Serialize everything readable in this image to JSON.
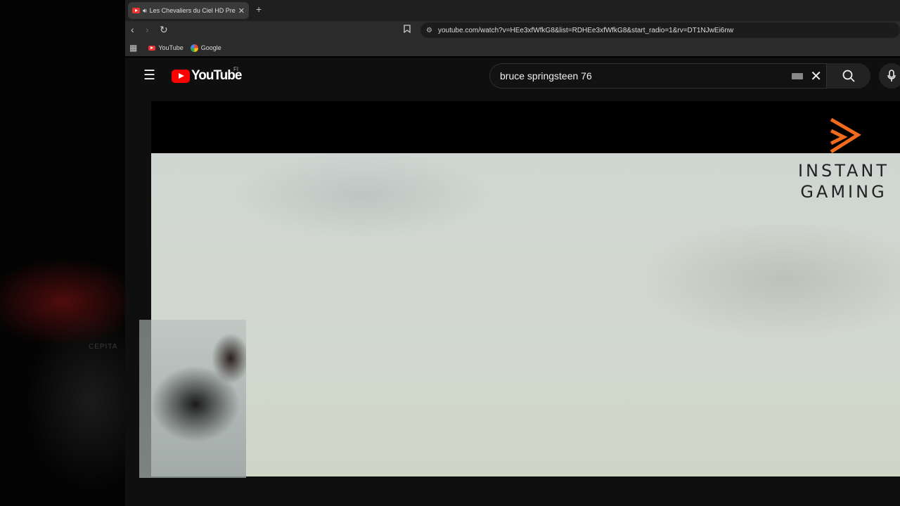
{
  "browser": {
    "tab": {
      "title": "Les Chevaliers du Ciel HD Pre",
      "audio_icon": "speaker-icon"
    },
    "toolbar": {
      "url": "youtube.com/watch?v=HEe3xfWfkG8&list=RDHEe3xfWfkG8&start_radio=1&rv=DT1NJwEi6nw"
    },
    "bookmarks": [
      {
        "label": "YouTube",
        "icon": "youtube-favicon"
      },
      {
        "label": "Google",
        "icon": "google-favicon"
      }
    ]
  },
  "youtube": {
    "logo_text": "YouTube",
    "country_code": "FI",
    "search": {
      "value": "bruce springsteen 76"
    }
  },
  "player": {
    "watermark": {
      "line1": "INSTANT",
      "line2": "GAMING"
    }
  },
  "colors": {
    "youtube_red": "#ff0000",
    "watermark_orange": "#f26b1d"
  }
}
